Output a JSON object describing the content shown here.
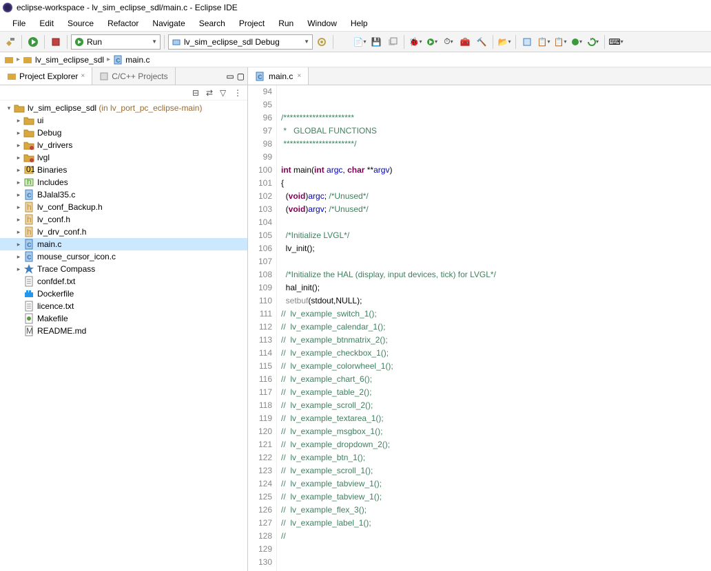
{
  "titlebar": "eclipse-workspace - lv_sim_eclipse_sdl/main.c - Eclipse IDE",
  "menu": [
    "File",
    "Edit",
    "Source",
    "Refactor",
    "Navigate",
    "Search",
    "Project",
    "Run",
    "Window",
    "Help"
  ],
  "toolbar": {
    "run_label": "Run",
    "debug_config": "lv_sim_eclipse_sdl Debug"
  },
  "breadcrumb": {
    "seg1": "lv_sim_eclipse_sdl",
    "seg2": "main.c"
  },
  "panel_tabs": {
    "active": "Project Explorer",
    "inactive": "C/C++ Projects"
  },
  "project_root": {
    "name": "lv_sim_eclipse_sdl",
    "hint": " (in lv_port_pc_eclipse-main)"
  },
  "tree": [
    {
      "type": "folder",
      "arrow": "closed",
      "label": "ui"
    },
    {
      "type": "folder",
      "arrow": "closed",
      "label": "Debug"
    },
    {
      "type": "folder-pkg",
      "arrow": "closed",
      "label": "lv_drivers"
    },
    {
      "type": "folder-pkg",
      "arrow": "closed",
      "label": "lvgl"
    },
    {
      "type": "binaries",
      "arrow": "closed",
      "label": "Binaries"
    },
    {
      "type": "includes",
      "arrow": "closed",
      "label": "Includes"
    },
    {
      "type": "cfile",
      "arrow": "closed",
      "label": "BJalal35.c"
    },
    {
      "type": "hfile",
      "arrow": "closed",
      "label": "lv_conf_Backup.h"
    },
    {
      "type": "hfile",
      "arrow": "closed",
      "label": "lv_conf.h"
    },
    {
      "type": "hfile",
      "arrow": "closed",
      "label": "lv_drv_conf.h"
    },
    {
      "type": "cfile",
      "arrow": "closed",
      "label": "main.c",
      "selected": true
    },
    {
      "type": "cfile",
      "arrow": "closed",
      "label": "mouse_cursor_icon.c"
    },
    {
      "type": "trace",
      "arrow": "closed",
      "label": "Trace Compass"
    },
    {
      "type": "txtfile",
      "arrow": "none",
      "label": "confdef.txt"
    },
    {
      "type": "docker",
      "arrow": "none",
      "label": "Dockerfile"
    },
    {
      "type": "txtfile",
      "arrow": "none",
      "label": "licence.txt"
    },
    {
      "type": "makefile",
      "arrow": "none",
      "label": "Makefile"
    },
    {
      "type": "mdfile",
      "arrow": "none",
      "label": "README.md"
    }
  ],
  "editor": {
    "tab": "main.c",
    "first_line": 94,
    "lines": [
      {
        "n": 94,
        "html": ""
      },
      {
        "n": 95,
        "html": ""
      },
      {
        "n": 96,
        "html": "<span class='tok-comment'>/**********************</span>"
      },
      {
        "n": 97,
        "html": "<span class='tok-comment'> *   GLOBAL FUNCTIONS</span>"
      },
      {
        "n": 98,
        "html": "<span class='tok-comment'> **********************/</span>"
      },
      {
        "n": 99,
        "html": ""
      },
      {
        "n": 100,
        "html": "<span class='tok-keyword'>int</span> <span class='tok-func'>main</span>(<span class='tok-keyword'>int</span> <span class='tok-ident'>argc</span>, <span class='tok-keyword'>char</span> **<span class='tok-ident'>argv</span>)"
      },
      {
        "n": 101,
        "html": "{"
      },
      {
        "n": 102,
        "html": "  (<span class='tok-keyword'>void</span>)<span class='tok-ident'>argc</span>; <span class='tok-comment'>/*Unused*/</span>"
      },
      {
        "n": 103,
        "html": "  (<span class='tok-keyword'>void</span>)<span class='tok-ident'>argv</span>; <span class='tok-comment'>/*Unused*/</span>"
      },
      {
        "n": 104,
        "html": ""
      },
      {
        "n": 105,
        "html": "  <span class='tok-comment'>/*Initialize LVGL*/</span>"
      },
      {
        "n": 106,
        "html": "  lv_init();"
      },
      {
        "n": 107,
        "html": ""
      },
      {
        "n": 108,
        "html": "  <span class='tok-comment'>/*Initialize the HAL (display, input devices, tick) for LVGL*/</span>"
      },
      {
        "n": 109,
        "html": "  hal_init();"
      },
      {
        "n": 110,
        "html": "  <span class='tok-dead'>setbuf</span>(stdout,NULL);"
      },
      {
        "n": 111,
        "html": "<span class='tok-comment'>//  lv_example_switch_1();</span>"
      },
      {
        "n": 112,
        "html": "<span class='tok-comment'>//  lv_example_calendar_1();</span>"
      },
      {
        "n": 113,
        "html": "<span class='tok-comment'>//  lv_example_btnmatrix_2();</span>"
      },
      {
        "n": 114,
        "html": "<span class='tok-comment'>//  lv_example_checkbox_1();</span>"
      },
      {
        "n": 115,
        "html": "<span class='tok-comment'>//  lv_example_colorwheel_1();</span>"
      },
      {
        "n": 116,
        "html": "<span class='tok-comment'>//  lv_example_chart_6();</span>"
      },
      {
        "n": 117,
        "html": "<span class='tok-comment'>//  lv_example_table_2();</span>"
      },
      {
        "n": 118,
        "html": "<span class='tok-comment'>//  lv_example_scroll_2();</span>"
      },
      {
        "n": 119,
        "html": "<span class='tok-comment'>//  lv_example_textarea_1();</span>"
      },
      {
        "n": 120,
        "html": "<span class='tok-comment'>//  lv_example_msgbox_1();</span>"
      },
      {
        "n": 121,
        "html": "<span class='tok-comment'>//  lv_example_dropdown_2();</span>"
      },
      {
        "n": 122,
        "html": "<span class='tok-comment'>//  lv_example_btn_1();</span>"
      },
      {
        "n": 123,
        "html": "<span class='tok-comment'>//  lv_example_scroll_1();</span>"
      },
      {
        "n": 124,
        "html": "<span class='tok-comment'>//  lv_example_tabview_1();</span>"
      },
      {
        "n": 125,
        "html": "<span class='tok-comment'>//  lv_example_tabview_1();</span>"
      },
      {
        "n": 126,
        "html": "<span class='tok-comment'>//  lv_example_flex_3();</span>"
      },
      {
        "n": 127,
        "html": "<span class='tok-comment'>//  lv_example_label_1();</span>"
      },
      {
        "n": 128,
        "html": "<span class='tok-comment'>//</span>"
      },
      {
        "n": 129,
        "html": ""
      },
      {
        "n": 130,
        "html": ""
      }
    ]
  }
}
